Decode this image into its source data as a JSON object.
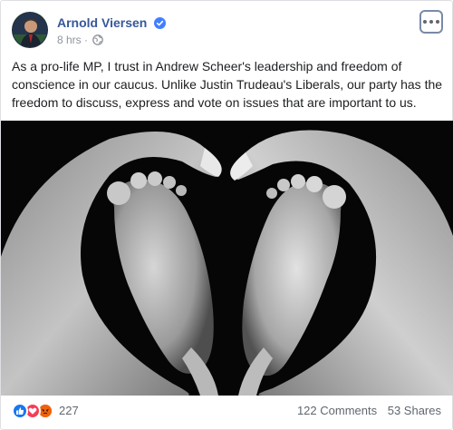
{
  "post": {
    "author": "Arnold Viersen",
    "time": "8 hrs",
    "separator": "·",
    "text": "As a pro-life MP, I trust in Andrew Scheer's leadership and freedom of conscience in our caucus. Unlike Justin Trudeau's Liberals, our party has the freedom to discuss, express and vote on issues that are important to us.",
    "privacy_icon": "globe-icon",
    "verified_icon": "verified-badge-icon",
    "menu_icon": "more-options-icon"
  },
  "photo": {
    "description_icon": "baby-feet-heart-hands-photo"
  },
  "footer": {
    "reaction_icons": [
      "like-icon",
      "love-icon",
      "angry-icon"
    ],
    "reaction_count": "227",
    "comments": "122 Comments",
    "shares": "53 Shares"
  },
  "colors": {
    "link": "#365899",
    "meta": "#90949c",
    "like": "#1877f2",
    "love": "#f33e58",
    "angry": "#e9710f"
  }
}
